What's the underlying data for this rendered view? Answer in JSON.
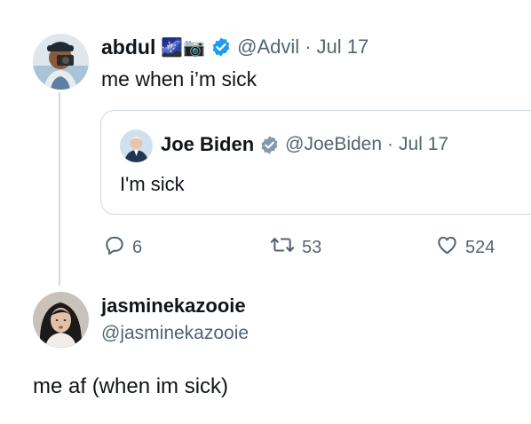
{
  "tweet": {
    "author_name": "abdul",
    "author_emojis": "🌌📷",
    "author_handle": "@Advil",
    "separator": "·",
    "date": "Jul 17",
    "text": "me when i’m sick",
    "quoted": {
      "author_name": "Joe Biden",
      "author_handle": "@JoeBiden",
      "separator": "·",
      "date": "Jul 17",
      "text": "I'm sick"
    },
    "actions": {
      "replies": "6",
      "retweets": "53",
      "likes": "524"
    }
  },
  "reply": {
    "author_name": "jasminekazooie",
    "author_handle": "@jasminekazooie",
    "text": "me af (when im sick)"
  },
  "colors": {
    "verified_blue": "#1d9bf0",
    "verified_gray": "#829aab",
    "text": "#0f1419",
    "muted": "#536471",
    "border": "#cfd9de"
  }
}
